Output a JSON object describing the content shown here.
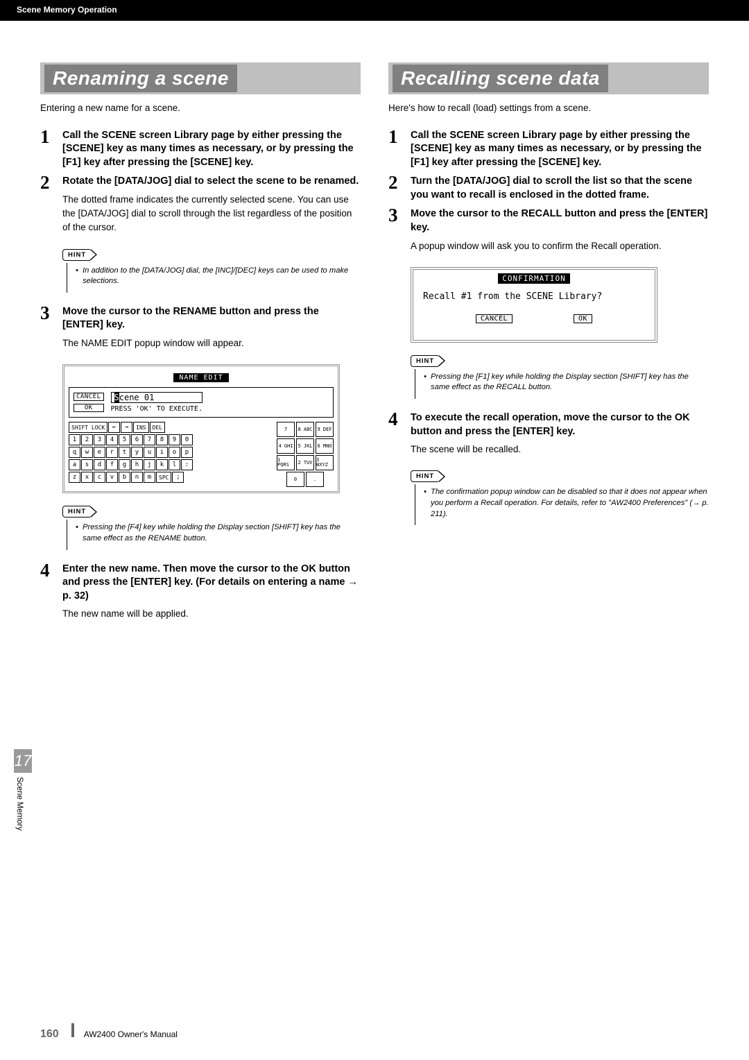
{
  "header": {
    "section": "Scene Memory Operation"
  },
  "left": {
    "headline": "Renaming a scene",
    "intro": "Entering a new name for a scene.",
    "steps": [
      {
        "num": "1",
        "head": "Call the SCENE screen Library page by either pressing the [SCENE] key as many times as necessary, or by pressing the [F1] key after pressing the [SCENE] key."
      },
      {
        "num": "2",
        "head": "Rotate the [DATA/JOG] dial to select the scene to be renamed.",
        "text": "The dotted frame indicates the currently selected scene. You can use the [DATA/JOG] dial to scroll through the list regardless of the position of the cursor."
      },
      {
        "num": "3",
        "head": "Move the cursor to the RENAME button and press the [ENTER] key.",
        "text": "The NAME EDIT popup window will appear."
      },
      {
        "num": "4",
        "head": "Enter the new name. Then move the cursor to the OK button and press the [ENTER] key. (For details on entering a name → p. 32)",
        "text": "The new name will be applied."
      }
    ],
    "hint1": "In addition to the [DATA/JOG] dial, the [INC]/[DEC] keys can be used to make selections.",
    "hint2": "Pressing the [F4] key while holding the Display section [SHIFT] key has the same effect as the RENAME button.",
    "name_edit": {
      "title": "NAME EDIT",
      "cancel": "CANCEL",
      "ok": "OK",
      "cursor_char": "S",
      "scene_rest": "cene 01",
      "instr": "PRESS 'OK' TO EXECUTE.",
      "top_row": [
        "SHIFT LOCK",
        "←",
        "→",
        "INS",
        "DEL"
      ],
      "row_nums": [
        "1",
        "2",
        "3",
        "4",
        "5",
        "6",
        "7",
        "8",
        "9",
        "0"
      ],
      "row_q": [
        "q",
        "w",
        "e",
        "r",
        "t",
        "y",
        "u",
        "i",
        "o",
        "p"
      ],
      "row_a": [
        "a",
        "s",
        "d",
        "f",
        "g",
        "h",
        "j",
        "k",
        "l",
        ":"
      ],
      "row_z_pre": [
        "z",
        "x",
        "c",
        "v",
        "b",
        "n",
        "m"
      ],
      "spc": "SPC",
      "row_z_last": ";",
      "pad": [
        [
          "7",
          "8 ABC",
          "9 DEF"
        ],
        [
          "4 GHI",
          "5 JKL",
          "6 MNO"
        ],
        [
          "1 PQRS",
          "2 TUV",
          "3 WXYZ"
        ],
        [
          "0",
          "."
        ]
      ]
    }
  },
  "right": {
    "headline": "Recalling scene data",
    "intro": "Here's how to recall (load) settings from a scene.",
    "steps": [
      {
        "num": "1",
        "head": "Call the SCENE screen Library page by either pressing the [SCENE] key as many times as necessary, or by pressing the [F1] key after pressing the [SCENE] key."
      },
      {
        "num": "2",
        "head": "Turn the [DATA/JOG] dial to scroll the list so that the scene you want to recall is enclosed in the dotted frame."
      },
      {
        "num": "3",
        "head": "Move the cursor to the RECALL button and press the [ENTER] key.",
        "text": "A popup window will ask you to confirm the Recall operation."
      },
      {
        "num": "4",
        "head": "To execute the recall operation, move the cursor to the OK button and press the [ENTER] key.",
        "text": "The scene will be recalled."
      }
    ],
    "hint1": "Pressing the [F1] key while holding the Display section [SHIFT] key has the same effect as the RECALL button.",
    "hint2": "The confirmation popup window can be disabled so that it does not appear when you perform a Recall operation. For details, refer to \"AW2400 Preferences\" (→ p. 211).",
    "confirm": {
      "title": "CONFIRMATION",
      "msg": "Recall #1 from the SCENE Library?",
      "cancel": "CANCEL",
      "ok": "OK"
    }
  },
  "hint_label": "HINT",
  "side_tab": {
    "num": "17",
    "label": "Scene Memory"
  },
  "footer": {
    "page": "160",
    "manual": "AW2400  Owner's Manual"
  }
}
